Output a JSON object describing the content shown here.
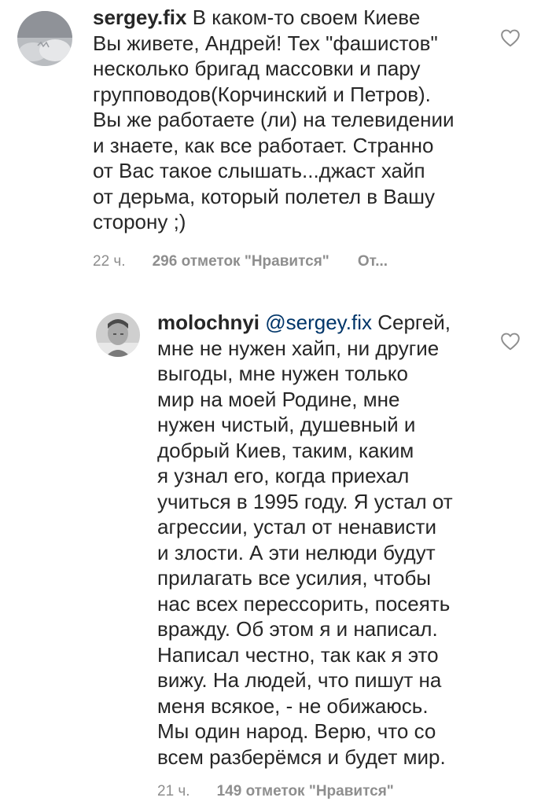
{
  "comments": [
    {
      "username": "sergey.fix",
      "mention": "",
      "text": " В каком-то своем Киеве\nВы живете, Андрей! Тех \"фашистов\"\nнесколько бригад массовки и пару\nгрупповодов(Корчинский и Петров).\nВы же работаете (ли) на телевидении\nи знаете, как все работает. Странно\nот Вас такое слышать...джаст хайп\nот дерьма, который полетел в Вашу\nсторону ;)",
      "time": "22 ч.",
      "likes": "296 отметок \"Нравится\"",
      "reply": "От...",
      "like_icon": "heart-outline-icon"
    },
    {
      "username": "molochnyi",
      "mention": "@sergey.fix",
      "text": " Сергей,\nмне не нужен хайп, ни другие\nвыгоды, мне нужен только\nмир на моей Родине, мне\nнужен чистый, душевный и\nдобрый Киев, таким, каким\nя узнал его, когда приехал\nучиться в 1995 году. Я устал от\nагрессии, устал от ненависти\nи злости. А эти нелюди будут\nприлагать все усилия, чтобы\nнас всех перессорить, посеять\nвражду. Об этом я и написал.\nНаписал честно, так как я это\nвижу. На людей, что пишут на\nменя всякое, - не обижаюсь.\nМы один народ. Верю, что со\nвсем разберёмся и будет мир.",
      "time": "21 ч.",
      "likes": "149 отметок \"Нравится\"",
      "like_icon": "heart-outline-icon"
    }
  ],
  "colors": {
    "text": "#262626",
    "meta": "#8e8e8e",
    "mention": "#003569"
  }
}
